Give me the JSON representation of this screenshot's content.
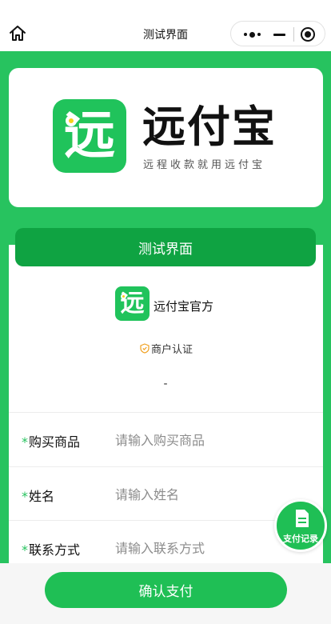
{
  "nav": {
    "title": "测试界面",
    "home_icon": "home-icon",
    "more_icon": "more-dots-icon",
    "minimize_icon": "minimize-icon",
    "close_icon": "target-circle-icon"
  },
  "brand": {
    "logo_char": "远",
    "name": "远付宝",
    "slogan": "远程收款就用远付宝"
  },
  "form": {
    "section_title": "测试界面",
    "merchant_logo_char": "远",
    "merchant_name": "远付宝官方",
    "verify_label": "商户认证",
    "dash": "-",
    "fields": [
      {
        "label": "购买商品",
        "placeholder": "请输入购买商品",
        "required": "*"
      },
      {
        "label": "姓名",
        "placeholder": "请输入姓名",
        "required": "*"
      },
      {
        "label": "联系方式",
        "placeholder": "请输入联系方式",
        "required": "*"
      }
    ]
  },
  "fab": {
    "label": "支付记录",
    "icon": "document-icon"
  },
  "actions": {
    "pay_label": "确认支付"
  },
  "colors": {
    "primary": "#27c35f",
    "ribbon": "#0fa342",
    "button": "#1fbf55"
  }
}
